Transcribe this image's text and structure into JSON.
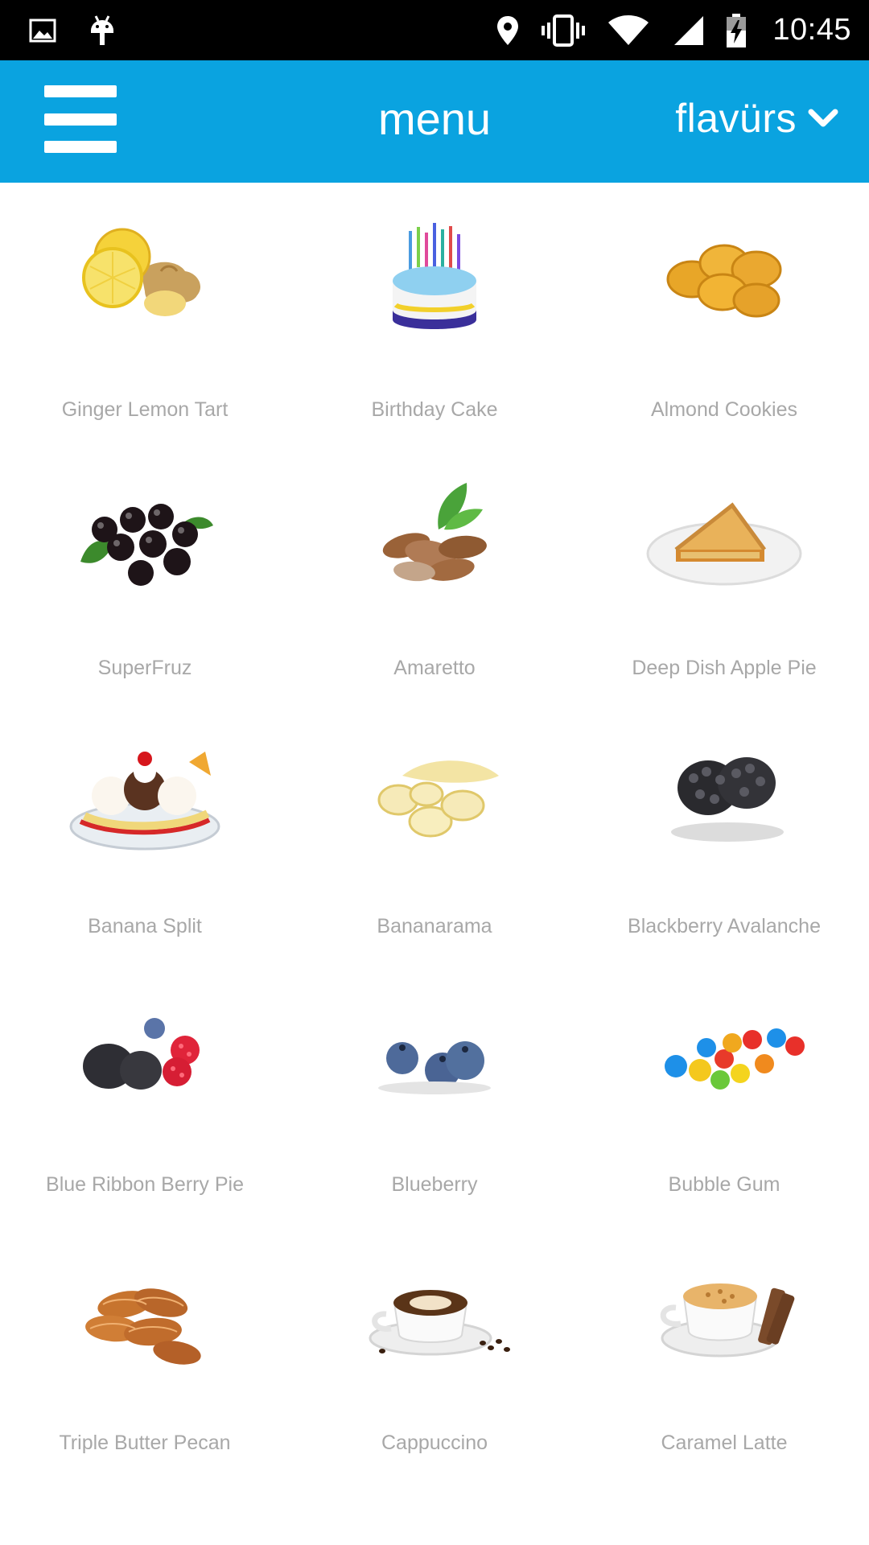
{
  "status_bar": {
    "time": "10:45",
    "left_icons": [
      "image-icon",
      "android-icon"
    ],
    "right_icons": [
      "location-icon",
      "vibrate-icon",
      "wifi-icon",
      "signal-icon",
      "battery-charging-icon"
    ]
  },
  "app_bar": {
    "title": "menu",
    "brand": "flavürs",
    "menu_icon": "hamburger-menu-icon",
    "dropdown_icon": "chevron-down-icon",
    "background_color": "#0aa3e0"
  },
  "flavors": [
    {
      "label": "Ginger Lemon Tart",
      "icon": "ginger-lemon-image"
    },
    {
      "label": "Birthday Cake",
      "icon": "birthday-cake-image"
    },
    {
      "label": "Almond Cookies",
      "icon": "almond-cookies-image"
    },
    {
      "label": "SuperFruz",
      "icon": "superfruz-berries-image"
    },
    {
      "label": "Amaretto",
      "icon": "almonds-image"
    },
    {
      "label": "Deep Dish Apple Pie",
      "icon": "apple-pie-image"
    },
    {
      "label": "Banana Split",
      "icon": "banana-split-image"
    },
    {
      "label": "Bananarama",
      "icon": "banana-slices-image"
    },
    {
      "label": "Blackberry Avalanche",
      "icon": "blackberries-image"
    },
    {
      "label": "Blue Ribbon Berry Pie",
      "icon": "mixed-berries-image"
    },
    {
      "label": "Blueberry",
      "icon": "blueberries-image"
    },
    {
      "label": "Bubble Gum",
      "icon": "gumballs-image"
    },
    {
      "label": "Triple Butter Pecan",
      "icon": "pecans-image"
    },
    {
      "label": "Cappuccino",
      "icon": "cappuccino-image"
    },
    {
      "label": "Caramel Latte",
      "icon": "caramel-latte-image"
    }
  ]
}
